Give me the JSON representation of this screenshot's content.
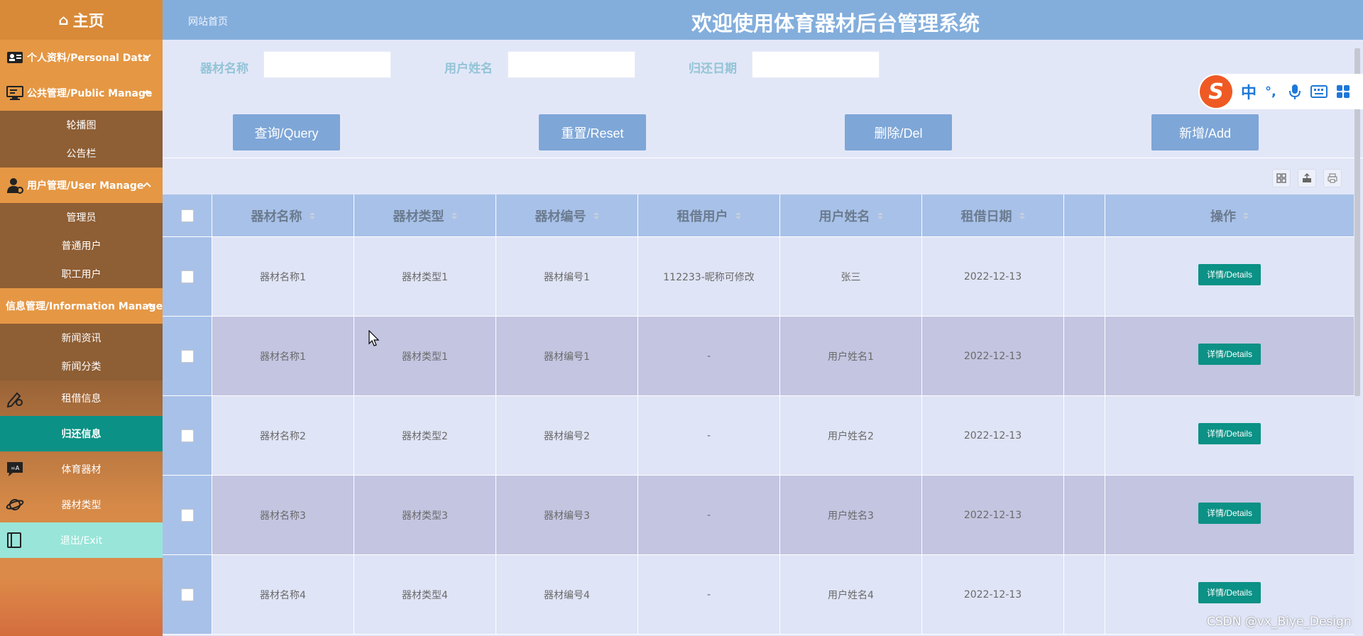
{
  "sidebar": {
    "brand": "主页",
    "groups": {
      "personal": "个人资料/Personal Data",
      "public": "公共管理/Public Manage",
      "user": "用户管理/User Manage",
      "info": "信息管理/Information Manage"
    },
    "public_items": [
      "轮播图",
      "公告栏"
    ],
    "user_items": [
      "管理员",
      "普通用户",
      "职工用户"
    ],
    "info_items": [
      "新闻资讯",
      "新闻分类"
    ],
    "items": {
      "rent": "租借信息",
      "return": "归还信息",
      "equipment": "体育器材",
      "equipment_type": "器材类型",
      "exit": "退出/Exit"
    }
  },
  "header": {
    "home_link": "网站首页",
    "title": "欢迎使用体育器材后台管理系统"
  },
  "search": {
    "fields": [
      {
        "label": "器材名称",
        "value": ""
      },
      {
        "label": "用户姓名",
        "value": ""
      },
      {
        "label": "归还日期",
        "value": ""
      }
    ]
  },
  "actions": {
    "query": "查询/Query",
    "reset": "重置/Reset",
    "delete": "删除/Del",
    "add": "新增/Add"
  },
  "table": {
    "headers": [
      "器材名称",
      "器材类型",
      "器材编号",
      "租借用户",
      "用户姓名",
      "租借日期",
      "",
      "操作"
    ],
    "rows": [
      [
        "器材名称1",
        "器材类型1",
        "器材编号1",
        "112233-昵称可修改",
        "张三",
        "2022-12-13"
      ],
      [
        "器材名称1",
        "器材类型1",
        "器材编号1",
        "-",
        "用户姓名1",
        "2022-12-13"
      ],
      [
        "器材名称2",
        "器材类型2",
        "器材编号2",
        "-",
        "用户姓名2",
        "2022-12-13"
      ],
      [
        "器材名称3",
        "器材类型3",
        "器材编号3",
        "-",
        "用户姓名3",
        "2022-12-13"
      ],
      [
        "器材名称4",
        "器材类型4",
        "器材编号4",
        "-",
        "用户姓名4",
        "2022-12-13"
      ]
    ],
    "details_label": "详情/Details"
  },
  "ime": {
    "chars": [
      "中",
      "°,"
    ]
  },
  "watermark": "CSDN @vx_Biye_Design",
  "colors": {
    "sidebar_orange": "#e59744",
    "sidebar_brown": "#8e5e34",
    "active_teal": "#0b9185",
    "exit_mint": "#99e5d9",
    "header_blue": "#83aedc",
    "button_blue": "#7ea6d7",
    "page_bg": "#e2e7f8"
  },
  "icons": [
    "home-icon",
    "id-card-icon",
    "monitor-icon",
    "user-gear-icon",
    "sitemap-icon",
    "pen-gear-icon",
    "chat-icon",
    "planet-icon",
    "book-icon",
    "grid-icon",
    "export-icon",
    "print-icon"
  ]
}
